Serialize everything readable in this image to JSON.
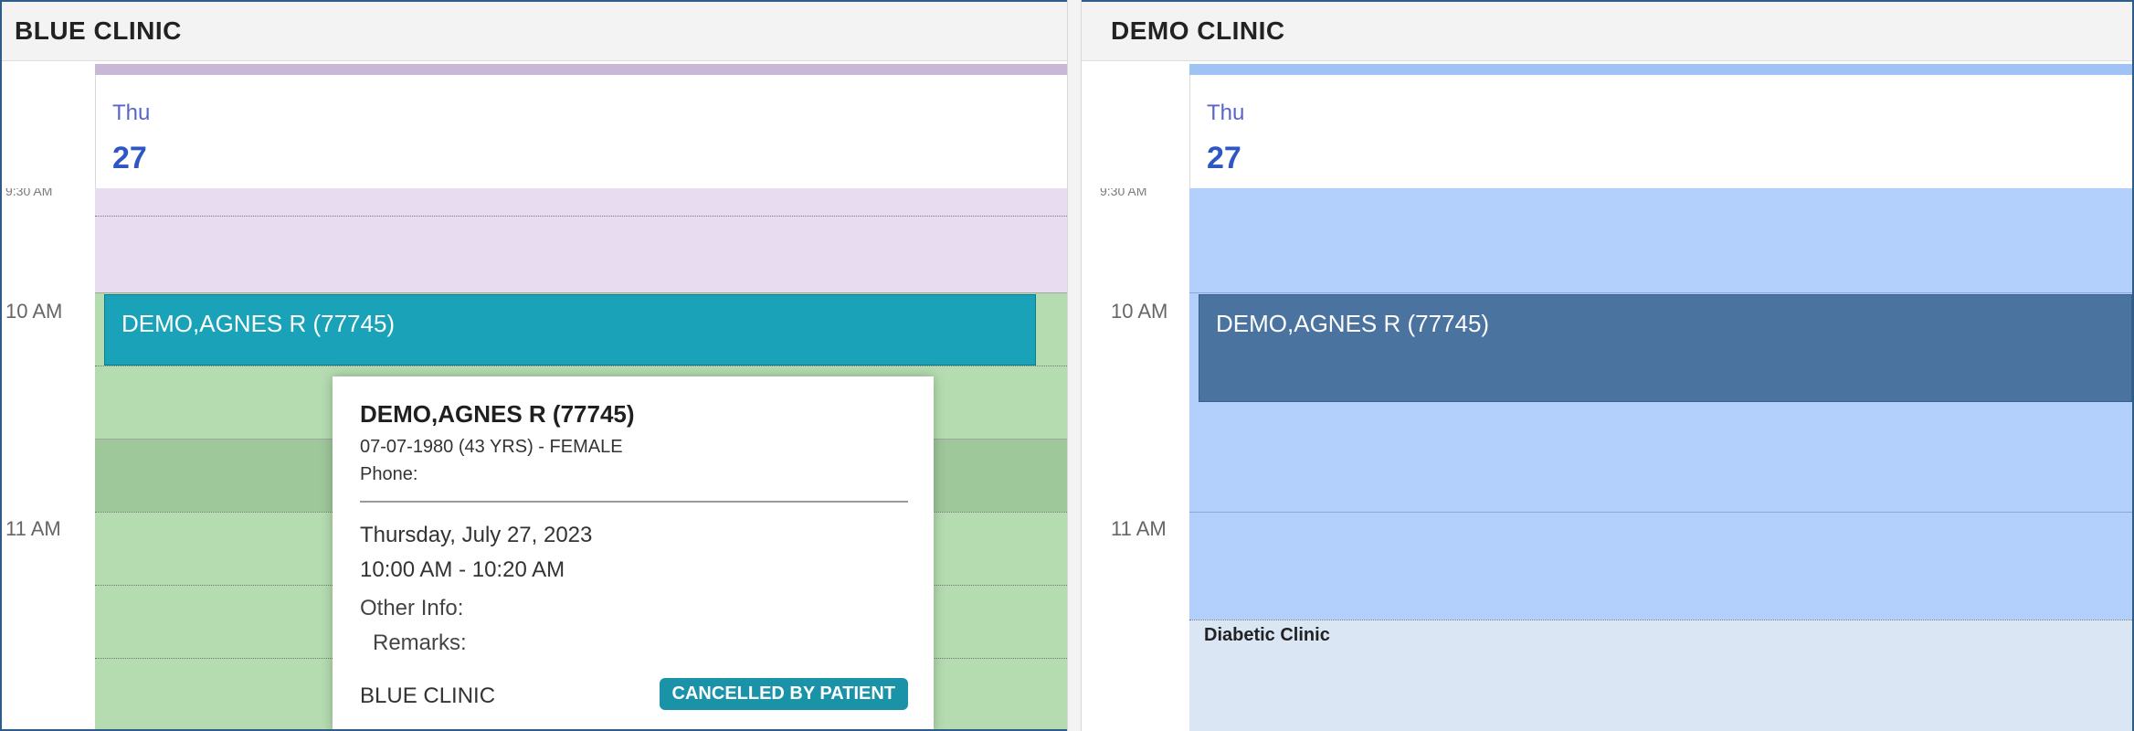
{
  "left": {
    "clinic_title": "BLUE CLINIC",
    "day_name": "Thu",
    "day_number": "27",
    "partial_time": "9:30 AM",
    "times": [
      "10 AM",
      "11 AM"
    ],
    "appointment": {
      "label": "DEMO,AGNES R (77745)",
      "color": "#1aa3b8"
    },
    "colors": {
      "bg_morning": "#e8dcf0",
      "bg_available": "#b5dcb0",
      "bg_hour_band": "#9ec79a"
    },
    "popup": {
      "name": "DEMO,AGNES R (77745)",
      "dob": "07-07-1980 (43 YRS) - FEMALE",
      "phone": "Phone:",
      "date": "Thursday, July 27, 2023",
      "time": "10:00 AM - 10:20 AM",
      "other_info": "Other Info:",
      "remarks": "Remarks:",
      "clinic": "BLUE CLINIC",
      "status": "CANCELLED BY PATIENT"
    }
  },
  "right": {
    "clinic_title": "DEMO CLINIC",
    "day_name": "Thu",
    "day_number": "27",
    "partial_time": "9:30 AM",
    "times": [
      "10 AM",
      "11 AM"
    ],
    "appointment": {
      "label": "DEMO,AGNES R (77745)",
      "color": "#4b73a0"
    },
    "block_label": "Diabetic Clinic",
    "colors": {
      "bg_available": "#b2d0fb",
      "bg_block": "#dae6f4"
    }
  }
}
